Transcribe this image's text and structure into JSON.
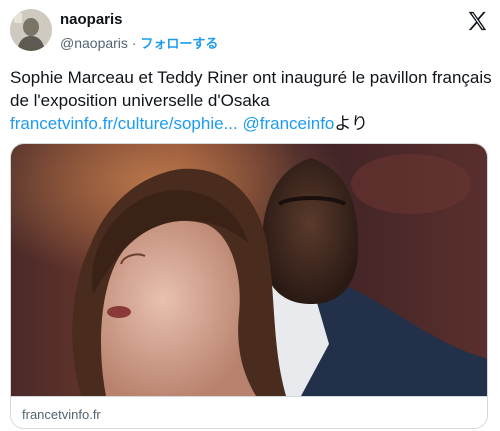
{
  "header": {
    "display_name": "naoparis",
    "handle": "@naoparis",
    "separator": "·",
    "follow_label": "フォローする",
    "avatar_icon": "profile-avatar",
    "platform_icon": "x-logo-icon"
  },
  "tweet": {
    "text_plain": "Sophie Marceau et Teddy Riner ont inauguré le pavillon français de l'exposition universelle d'Osaka ",
    "link_text": "francetvinfo.fr/culture/sophie...",
    "mention": "@franceinfo",
    "suffix": "より"
  },
  "card": {
    "domain": "francetvinfo.fr",
    "image_alt": "photo-two-people"
  },
  "colors": {
    "accent": "#1d9bf0",
    "text": "#0f1419",
    "muted": "#536471",
    "border": "#cfd9de"
  }
}
